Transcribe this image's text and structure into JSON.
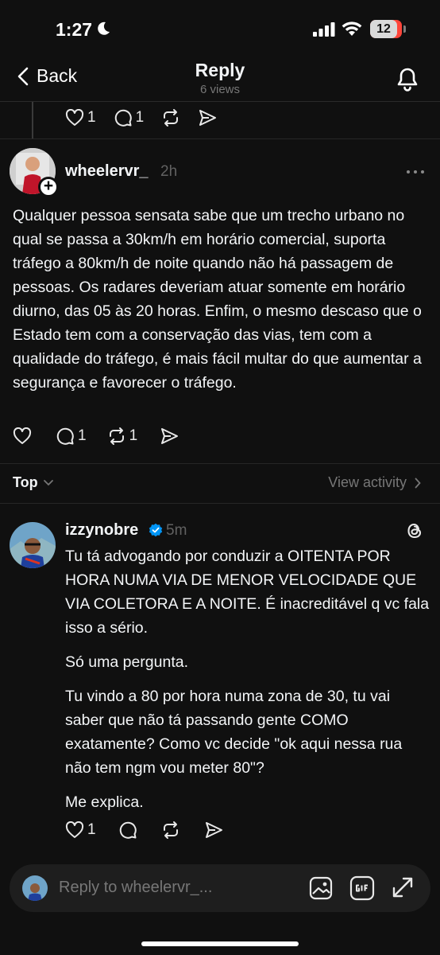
{
  "status_bar": {
    "time": "1:27",
    "battery": "12"
  },
  "header": {
    "back_label": "Back",
    "title": "Reply",
    "subtitle": "6 views"
  },
  "parent_actions": {
    "likes": "1",
    "comments": "1"
  },
  "post": {
    "username": "wheelervr_",
    "time": "2h",
    "text": "Qualquer pessoa sensata sabe que um trecho urbano no qual se passa a 30km/h em horário comercial, suporta tráfego a 80km/h de noite quando não há passagem de pessoas. Os radares deveriam atuar somente em horário diurno, das 05 às 20 horas. Enfim, o mesmo descaso que o Estado tem com a conservação das vias, tem com a qualidade do tráfego, é mais fácil multar do que aumentar a segurança e favorecer o tráfego.",
    "comments": "1",
    "reposts": "1"
  },
  "sort": {
    "label": "Top",
    "view_activity": "View activity"
  },
  "reply": {
    "username": "izzynobre",
    "time": "5m",
    "paragraphs": [
      "Tu tá advogando por conduzir a OITENTA POR HORA NUMA VIA DE MENOR VELOCIDADE QUE VIA COLETORA E A NOITE. É inacreditável q vc fala isso a sério.",
      "Só uma pergunta.",
      "Tu vindo a 80 por hora numa zona de 30, tu vai saber que não tá passando gente COMO exatamente? Como vc decide \"ok aqui nessa rua não tem ngm vou meter 80\"?",
      "Me explica."
    ],
    "likes": "1"
  },
  "composer": {
    "placeholder": "Reply to wheelervr_..."
  },
  "colors": {
    "background": "#101010",
    "text": "#f3f5f7",
    "muted": "#616161",
    "verified": "#0095f6"
  }
}
